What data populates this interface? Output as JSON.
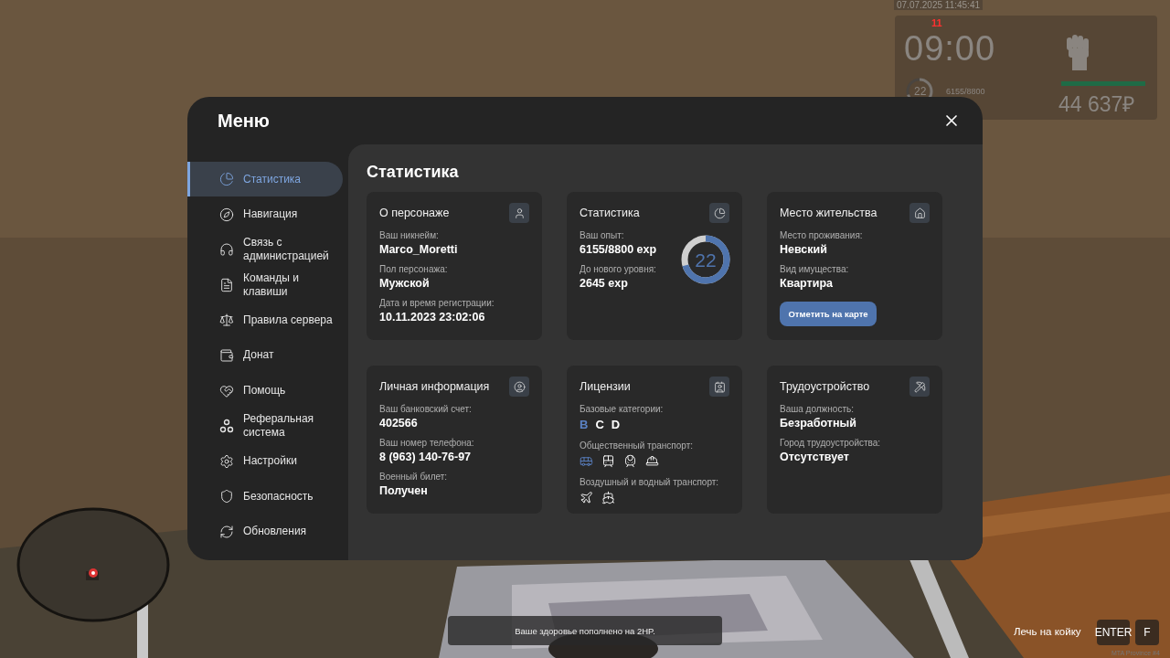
{
  "hud": {
    "date": "07.07.2025 11:45:41",
    "mark": "11",
    "time": "09:00",
    "level": "22",
    "xp": "6155/8800",
    "money": "44 637₽"
  },
  "menu": {
    "title": "Меню",
    "sidebar": {
      "items": [
        {
          "label": "Статистика",
          "selected": true
        },
        {
          "label": "Навигация",
          "selected": false
        },
        {
          "label": "Связь с администрацией",
          "selected": false
        },
        {
          "label": "Команды и клавиши",
          "selected": false
        },
        {
          "label": "Правила сервера",
          "selected": false
        },
        {
          "label": "Донат",
          "selected": false
        },
        {
          "label": "Помощь",
          "selected": false
        },
        {
          "label": "Реферальная система",
          "selected": false
        },
        {
          "label": "Настройки",
          "selected": false
        },
        {
          "label": "Безопасность",
          "selected": false
        },
        {
          "label": "Обновления",
          "selected": false
        }
      ]
    },
    "content": {
      "title": "Статистика",
      "cards": [
        {
          "title": "О персонаже",
          "fields": [
            {
              "label": "Ваш никнейм:",
              "value": "Marco_Moretti"
            },
            {
              "label": "Пол персонажа:",
              "value": "Мужской"
            },
            {
              "label": "Дата и время регистрации:",
              "value": "10.11.2023 23:02:06"
            }
          ]
        },
        {
          "title": "Статистика",
          "fields": [
            {
              "label": "Ваш опыт:",
              "value": "6155/8800 exp"
            },
            {
              "label": "До нового уровня:",
              "value": "2645 exp"
            }
          ],
          "ring": {
            "value": "22"
          }
        },
        {
          "title": "Место жительства",
          "fields": [
            {
              "label": "Место проживания:",
              "value": "Невский"
            },
            {
              "label": "Вид имущества:",
              "value": "Квартира"
            }
          ],
          "button": "Отметить на карте"
        },
        {
          "title": "Личная информация",
          "fields": [
            {
              "label": "Ваш банковский счет:",
              "value": "402566"
            },
            {
              "label": "Ваш номер телефона:",
              "value": "8 (963) 140-76-97"
            },
            {
              "label": "Военный билет:",
              "value": "Получен"
            }
          ]
        },
        {
          "title": "Лицензии",
          "sections": [
            {
              "kind": "letters",
              "label": "Базовые категории:",
              "items": [
                {
                  "text": "B",
                  "owned": true
                },
                {
                  "text": "C",
                  "owned": false
                },
                {
                  "text": "D",
                  "owned": false
                }
              ]
            },
            {
              "kind": "icons",
              "label": "Общественный транспорт:",
              "items": [
                {
                  "owned": true
                },
                {
                  "owned": false
                },
                {
                  "owned": false
                },
                {
                  "owned": false
                }
              ]
            },
            {
              "kind": "icons",
              "label": "Воздушный и водный транспорт:",
              "items": [
                {
                  "owned": false
                },
                {
                  "owned": false
                }
              ]
            }
          ]
        },
        {
          "title": "Трудоустройство",
          "fields": [
            {
              "label": "Ваша должность:",
              "value": "Безработный"
            },
            {
              "label": "Город трудоустройства:",
              "value": "Отсутствует"
            }
          ]
        }
      ]
    }
  },
  "notification": "Ваше здоровье пополнено на 2HP.",
  "prompt": {
    "label": "Лечь на койку",
    "keys": [
      "ENTER",
      "F"
    ]
  },
  "server_label": "MTA Province #4"
}
